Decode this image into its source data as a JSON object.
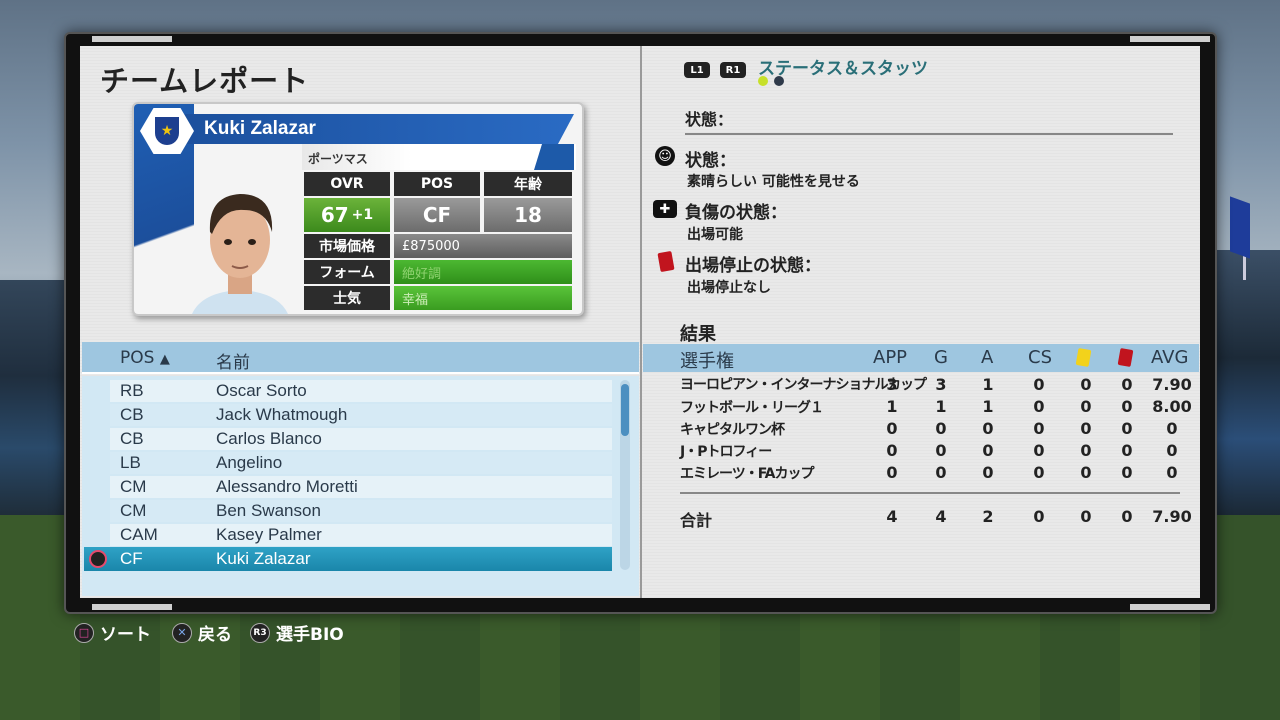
{
  "page_title": "チームレポート",
  "player": {
    "name": "Kuki Zalazar",
    "club": "ポーツマス",
    "ovr_label": "OVR",
    "pos_label": "POS",
    "age_label": "年齢",
    "ovr": "67",
    "ovr_change": "+1",
    "pos": "CF",
    "age": "18",
    "value_label": "市場価格",
    "value": "£875000",
    "form_label": "フォーム",
    "form": "絶好調",
    "morale_label": "士気",
    "morale": "幸福"
  },
  "list": {
    "col_pos": "POS",
    "col_name": "名前",
    "rows": [
      {
        "pos": "RB",
        "name": "Oscar Sorto"
      },
      {
        "pos": "CB",
        "name": "Jack Whatmough"
      },
      {
        "pos": "CB",
        "name": "Carlos Blanco"
      },
      {
        "pos": "LB",
        "name": "Angelino"
      },
      {
        "pos": "CM",
        "name": "Alessandro Moretti"
      },
      {
        "pos": "CM",
        "name": "Ben Swanson"
      },
      {
        "pos": "CAM",
        "name": "Kasey Palmer"
      },
      {
        "pos": "CF",
        "name": "Kuki Zalazar"
      }
    ],
    "selected_index": 7
  },
  "right": {
    "l1": "L1",
    "r1": "R1",
    "tab_title": "ステータス＆スタッツ",
    "status_label": "状態：",
    "condition_head": "状態：",
    "condition_value": "素晴らしい 可能性を見せる",
    "injury_head": "負傷の状態：",
    "injury_value": "出場可能",
    "suspension_head": "出場停止の状態：",
    "suspension_value": "出場停止なし",
    "results_label": "結果",
    "table_head": {
      "comp": "選手権",
      "app": "APP",
      "g": "G",
      "a": "A",
      "cs": "CS",
      "avg": "AVG"
    },
    "rows": [
      {
        "comp": "ヨーロピアン・インターナショナルカップ",
        "app": "3",
        "g": "3",
        "a": "1",
        "cs": "0",
        "y": "0",
        "r": "0",
        "avg": "7.90"
      },
      {
        "comp": "フットボール・リーグ１",
        "app": "1",
        "g": "1",
        "a": "1",
        "cs": "0",
        "y": "0",
        "r": "0",
        "avg": "8.00"
      },
      {
        "comp": "キャピタルワン杯",
        "app": "0",
        "g": "0",
        "a": "0",
        "cs": "0",
        "y": "0",
        "r": "0",
        "avg": "0"
      },
      {
        "comp": "J・Pトロフィー",
        "app": "0",
        "g": "0",
        "a": "0",
        "cs": "0",
        "y": "0",
        "r": "0",
        "avg": "0"
      },
      {
        "comp": "エミレーツ・FAカップ",
        "app": "0",
        "g": "0",
        "a": "0",
        "cs": "0",
        "y": "0",
        "r": "0",
        "avg": "0"
      }
    ],
    "total": {
      "comp": "合計",
      "app": "4",
      "g": "4",
      "a": "2",
      "cs": "0",
      "y": "0",
      "r": "0",
      "avg": "7.90"
    }
  },
  "hints": {
    "sort_btn": "□",
    "sort": "ソート",
    "back_btn": "✕",
    "back": "戻る",
    "bio_btn": "R3",
    "bio": "選手BIO"
  },
  "colors": {
    "accent_blue": "#1d5aa9",
    "selection": "#1a86aa",
    "form_green": "#3aa827"
  }
}
